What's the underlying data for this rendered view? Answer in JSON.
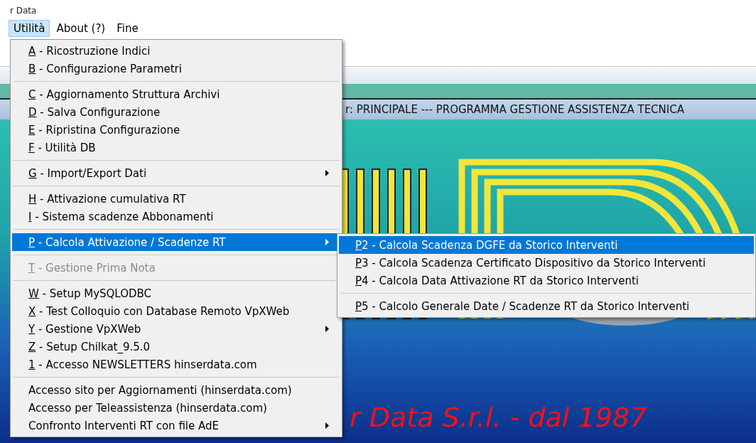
{
  "window": {
    "title": "r Data"
  },
  "menu_bar": [
    {
      "label": "Utilità",
      "selected": true
    },
    {
      "label": "About (?)",
      "selected": false
    },
    {
      "label": "Fine",
      "selected": false
    }
  ],
  "main_window": {
    "title": "r: PRINCIPALE --- PROGRAMMA GESTIONE ASSISTENZA TECNICA",
    "logo_text": "r Data S.r.l. - dal 1987"
  },
  "menu": [
    {
      "kind": "item",
      "key": "A",
      "label": " - Ricostruzione Indici",
      "submenu": false,
      "disabled": false,
      "selected": false
    },
    {
      "kind": "item",
      "key": "B",
      "label": " - Configurazione Parametri",
      "submenu": false,
      "disabled": false,
      "selected": false
    },
    {
      "kind": "separator"
    },
    {
      "kind": "item",
      "key": "C",
      "label": " - Aggiornamento Struttura Archivi",
      "submenu": false,
      "disabled": false,
      "selected": false
    },
    {
      "kind": "item",
      "key": "D",
      "label": " - Salva Configurazione",
      "submenu": false,
      "disabled": false,
      "selected": false
    },
    {
      "kind": "item",
      "key": "E",
      "label": " - Ripristina Configurazione",
      "submenu": false,
      "disabled": false,
      "selected": false
    },
    {
      "kind": "item",
      "key": "F",
      "label": " - Utilità DB",
      "submenu": false,
      "disabled": false,
      "selected": false
    },
    {
      "kind": "separator"
    },
    {
      "kind": "item",
      "key": "G",
      "label": " - Import/Export Dati",
      "submenu": true,
      "disabled": false,
      "selected": false
    },
    {
      "kind": "separator"
    },
    {
      "kind": "item",
      "key": "H",
      "label": " - Attivazione cumulativa RT",
      "submenu": false,
      "disabled": false,
      "selected": false
    },
    {
      "kind": "item",
      "key": "I",
      "label": " - Sistema scadenze Abbonamenti",
      "submenu": false,
      "disabled": false,
      "selected": false
    },
    {
      "kind": "separator"
    },
    {
      "kind": "item",
      "key": "P",
      "label": " - Calcola Attivazione / Scadenze RT",
      "submenu": true,
      "disabled": false,
      "selected": true
    },
    {
      "kind": "separator"
    },
    {
      "kind": "item",
      "key": "T",
      "label": " - Gestione Prima Nota",
      "submenu": false,
      "disabled": true,
      "selected": false
    },
    {
      "kind": "separator"
    },
    {
      "kind": "item",
      "key": "W",
      "label": " - Setup MySQLODBC",
      "submenu": false,
      "disabled": false,
      "selected": false
    },
    {
      "kind": "item",
      "key": "X",
      "label": " - Test Colloquio con Database Remoto VpXWeb",
      "submenu": false,
      "disabled": false,
      "selected": false
    },
    {
      "kind": "item",
      "key": "Y",
      "label": " - Gestione VpXWeb",
      "submenu": true,
      "disabled": false,
      "selected": false
    },
    {
      "kind": "item",
      "key": "Z",
      "label": " - Setup Chilkat_9.5.0",
      "submenu": false,
      "disabled": false,
      "selected": false
    },
    {
      "kind": "item",
      "key": "1",
      "label": " - Accesso NEWSLETTERS hinserdata.com",
      "submenu": false,
      "disabled": false,
      "selected": false
    },
    {
      "kind": "separator"
    },
    {
      "kind": "item",
      "label": "Accesso sito per Aggiornamenti (hinserdata.com)",
      "submenu": false,
      "disabled": false,
      "selected": false
    },
    {
      "kind": "item",
      "label": "Accesso per Teleassistenza (hinserdata.com)",
      "submenu": false,
      "disabled": false,
      "selected": false
    },
    {
      "kind": "item",
      "label": "Confronto Interventi RT con file  AdE",
      "submenu": true,
      "disabled": false,
      "selected": false
    }
  ],
  "submenu": [
    {
      "kind": "item",
      "key": "P",
      "label": "2 - Calcola Scadenza DGFE da Storico Interventi",
      "submenu": false,
      "disabled": false,
      "selected": true
    },
    {
      "kind": "item",
      "key": "P",
      "label": "3 - Calcola Scadenza Certificato Dispositivo da Storico Interventi",
      "submenu": false,
      "disabled": false,
      "selected": false
    },
    {
      "kind": "item",
      "key": "P",
      "label": "4 - Calcola Data Attivazione RT da Storico Interventi",
      "submenu": false,
      "disabled": false,
      "selected": false
    },
    {
      "kind": "separator"
    },
    {
      "kind": "item",
      "key": "P",
      "label": "5 - Calcolo Generale Date / Scadenze RT da Storico Interventi",
      "submenu": false,
      "disabled": false,
      "selected": false
    }
  ]
}
